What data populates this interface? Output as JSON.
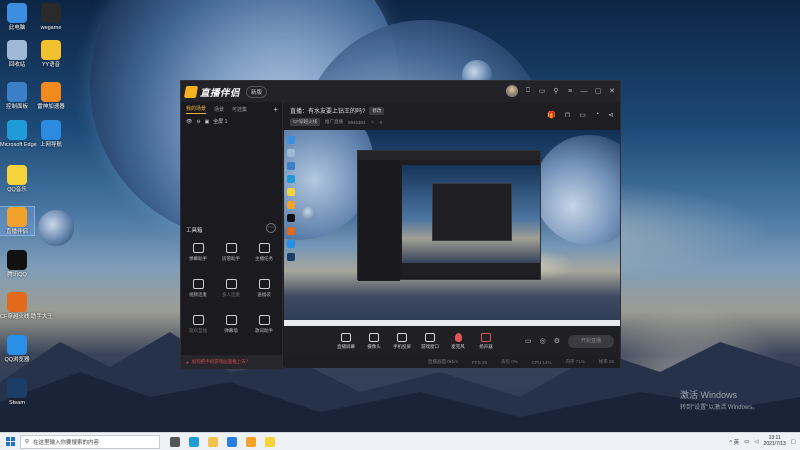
{
  "desktop": {
    "icons": [
      {
        "label": "此电脑",
        "color": "#3c8ee0"
      },
      {
        "label": "wegame",
        "color": "#2a2a2a"
      },
      {
        "label": "回收站",
        "color": "#9fb9d6"
      },
      {
        "label": "YY语音",
        "color": "#f2c12e"
      },
      {
        "label": "控制面板",
        "color": "#3a7fc7"
      },
      {
        "label": "雷神加速器",
        "color": "#f08a1c"
      },
      {
        "label": "Microsoft Edge",
        "color": "#1f9bd8"
      },
      {
        "label": "上网导航",
        "color": "#2c8ae0"
      },
      {
        "label": "QQ音乐",
        "color": "#f4d43a"
      },
      {
        "label": "直播伴侣",
        "color": "#f2a12a"
      },
      {
        "label": "腾讯QQ",
        "color": "#111111"
      },
      {
        "label": "CF穿越火线 助手大王",
        "color": "#e36a1c"
      },
      {
        "label": "QQ浏览器",
        "color": "#2a8fe6"
      },
      {
        "label": "Steam",
        "color": "#1b3d66"
      }
    ]
  },
  "app": {
    "logo_text": "直播伴侣",
    "version_badge": "新版",
    "window_controls": [
      "⎕",
      "▭",
      "⚲",
      "≡",
      "—",
      "▢",
      "✕"
    ],
    "tabs": [
      {
        "label": "我的场景",
        "active": true
      },
      {
        "label": "场景",
        "active": false
      },
      {
        "label": "可选集",
        "active": false
      }
    ],
    "add_label": "+",
    "scene_name": "全屏 1",
    "tools_title": "工具箱",
    "tools": [
      {
        "label": "弹幕助手",
        "dim": false
      },
      {
        "label": "房管助手",
        "dim": false
      },
      {
        "label": "主播任务",
        "dim": false
      },
      {
        "label": "视频连麦",
        "dim": false
      },
      {
        "label": "多人连麦",
        "dim": true
      },
      {
        "label": "送福袋",
        "dim": false
      },
      {
        "label": "观众互动",
        "dim": true
      },
      {
        "label": "弹幕墙",
        "dim": false
      },
      {
        "label": "歌词助手",
        "dim": false
      }
    ],
    "notice": "如何把手机游戏画面推上去？",
    "room": {
      "title": "直播：有水友要上钻王的吗?",
      "title_tag": "修改",
      "category": "CF穿越火线",
      "popularity_label": "推广直播",
      "popularity_value": "9945384",
      "fans": "0"
    },
    "controls": [
      {
        "label": "直播屏幕",
        "type": "screen"
      },
      {
        "label": "摄像头",
        "type": "camera"
      },
      {
        "label": "手机投屏",
        "type": "phone"
      },
      {
        "label": "游戏窗口",
        "type": "window"
      },
      {
        "label": "麦克风",
        "type": "mic"
      },
      {
        "label": "扬声器",
        "type": "speaker"
      }
    ],
    "go_live_label": "开始直播",
    "status": [
      "直播画面 0kb/s",
      "FPS 25",
      "丢包 0%",
      "CPU 14%",
      "内存 71%",
      "帧率 25"
    ]
  },
  "watermark": {
    "line1": "激活 Windows",
    "line2": "转到\"设置\"以激活 Windows。"
  },
  "taskbar": {
    "search_placeholder": "在这里输入你要搜索的内容",
    "apps": [
      {
        "name": "task-view",
        "color": "#555555"
      },
      {
        "name": "edge",
        "color": "#1f9bd8"
      },
      {
        "name": "file-explorer",
        "color": "#f2c14e"
      },
      {
        "name": "store",
        "color": "#2a7de1"
      },
      {
        "name": "live-companion",
        "color": "#f2a12a"
      },
      {
        "name": "qq-music",
        "color": "#f4d43a"
      }
    ],
    "tray": "^ 英",
    "time": "13:11",
    "date": "2021/7/13"
  }
}
